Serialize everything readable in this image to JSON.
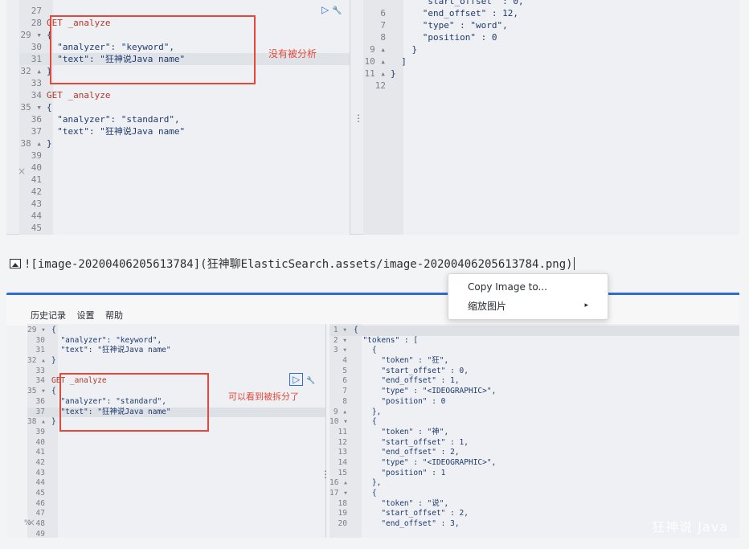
{
  "top_editor": {
    "left_lines": [
      {
        "n": "27",
        "t": ""
      },
      {
        "n": "28",
        "t": "GET _analyze",
        "kw": true
      },
      {
        "n": "29 ▾",
        "t": "{"
      },
      {
        "n": "30",
        "t": "  \"analyzer\": \"keyword\","
      },
      {
        "n": "31",
        "t": "  \"text\": \"狂神说Java name\""
      },
      {
        "n": "32 ▴",
        "t": "}"
      },
      {
        "n": "33",
        "t": ""
      },
      {
        "n": "34",
        "t": "GET _analyze",
        "kw": true
      },
      {
        "n": "35 ▾",
        "t": "{"
      },
      {
        "n": "36",
        "t": "  \"analyzer\": \"standard\","
      },
      {
        "n": "37",
        "t": "  \"text\": \"狂神说Java name\""
      },
      {
        "n": "38 ▴",
        "t": "}"
      },
      {
        "n": "39",
        "t": ""
      },
      {
        "n": "40",
        "t": ""
      },
      {
        "n": "41",
        "t": ""
      },
      {
        "n": "42",
        "t": ""
      },
      {
        "n": "43",
        "t": ""
      },
      {
        "n": "44",
        "t": ""
      },
      {
        "n": "45",
        "t": ""
      }
    ],
    "right_lines": [
      {
        "n": "",
        "t": "      \"start_offset\" : 0,"
      },
      {
        "n": "6",
        "t": "      \"end_offset\" : 12,"
      },
      {
        "n": "7",
        "t": "      \"type\" : \"word\","
      },
      {
        "n": "8",
        "t": "      \"position\" : 0"
      },
      {
        "n": "9 ▴",
        "t": "    }"
      },
      {
        "n": "10 ▴",
        "t": "  ]"
      },
      {
        "n": "11 ▴",
        "t": "}"
      },
      {
        "n": "12",
        "t": ""
      }
    ],
    "note": "没有被分析",
    "play_icon": "▷",
    "wrench_icon": "🔧"
  },
  "markdown_line": {
    "text": "![image-20200406205613784](狂神聊ElasticSearch.assets/image-20200406205613784.png)"
  },
  "context_menu": {
    "items": [
      "Copy Image to...",
      "缩放图片"
    ],
    "submenu_arrow": "▸"
  },
  "bottom_editor": {
    "menu": [
      "历史记录",
      "设置",
      "帮助"
    ],
    "left_lines": [
      {
        "n": "29 ▾",
        "t": "{"
      },
      {
        "n": "30",
        "t": "  \"analyzer\": \"keyword\","
      },
      {
        "n": "31",
        "t": "  \"text\": \"狂神说Java name\""
      },
      {
        "n": "32 ▴",
        "t": "}"
      },
      {
        "n": "33",
        "t": ""
      },
      {
        "n": "34",
        "t": "GET _analyze",
        "kw": true
      },
      {
        "n": "35 ▾",
        "t": "{"
      },
      {
        "n": "36",
        "t": "  \"analyzer\": \"standard\","
      },
      {
        "n": "37",
        "t": "  \"text\": \"狂神说Java name\""
      },
      {
        "n": "38 ▴",
        "t": "}"
      },
      {
        "n": "39",
        "t": ""
      },
      {
        "n": "40",
        "t": ""
      },
      {
        "n": "41",
        "t": ""
      },
      {
        "n": "42",
        "t": ""
      },
      {
        "n": "43",
        "t": ""
      },
      {
        "n": "44",
        "t": ""
      },
      {
        "n": "45",
        "t": ""
      },
      {
        "n": "46",
        "t": ""
      },
      {
        "n": "47",
        "t": ""
      },
      {
        "n": "48",
        "t": ""
      },
      {
        "n": "49",
        "t": ""
      }
    ],
    "right_lines": [
      {
        "n": "1 ▾",
        "t": "{"
      },
      {
        "n": "2 ▾",
        "t": "  \"tokens\" : ["
      },
      {
        "n": "3 ▾",
        "t": "    {"
      },
      {
        "n": "4",
        "t": "      \"token\" : \"狂\","
      },
      {
        "n": "5",
        "t": "      \"start_offset\" : 0,"
      },
      {
        "n": "6",
        "t": "      \"end_offset\" : 1,"
      },
      {
        "n": "7",
        "t": "      \"type\" : \"<IDEOGRAPHIC>\","
      },
      {
        "n": "8",
        "t": "      \"position\" : 0"
      },
      {
        "n": "9 ▴",
        "t": "    },"
      },
      {
        "n": "10 ▾",
        "t": "    {"
      },
      {
        "n": "11",
        "t": "      \"token\" : \"神\","
      },
      {
        "n": "12",
        "t": "      \"start_offset\" : 1,"
      },
      {
        "n": "13",
        "t": "      \"end_offset\" : 2,"
      },
      {
        "n": "14",
        "t": "      \"type\" : \"<IDEOGRAPHIC>\","
      },
      {
        "n": "15",
        "t": "      \"position\" : 1"
      },
      {
        "n": "16 ▴",
        "t": "    },"
      },
      {
        "n": "17 ▾",
        "t": "    {"
      },
      {
        "n": "18",
        "t": "      \"token\" : \"说\","
      },
      {
        "n": "19",
        "t": "      \"start_offset\" : 2,"
      },
      {
        "n": "20",
        "t": "      \"end_offset\" : 3,"
      }
    ],
    "note": "可以看到被拆分了",
    "play_icon": "▷",
    "wrench_icon": "🔧",
    "percent": "%"
  },
  "watermark": "狂神说 Java"
}
